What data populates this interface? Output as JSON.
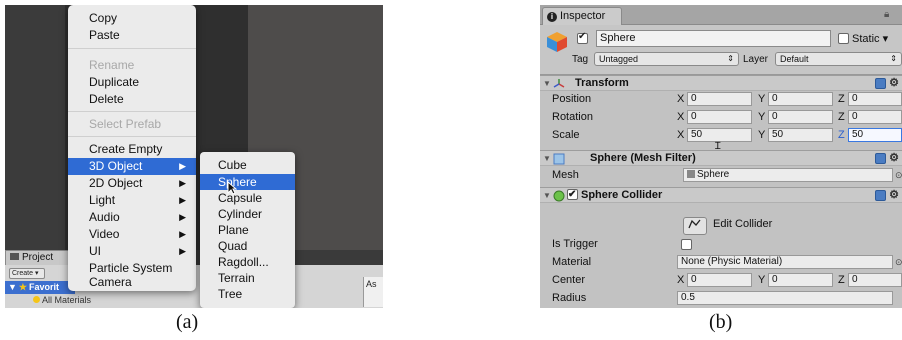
{
  "panel_a": {
    "context_menu": {
      "items": [
        {
          "label": "Copy",
          "enabled": true
        },
        {
          "label": "Paste",
          "enabled": true
        },
        {
          "label": "Rename",
          "enabled": false
        },
        {
          "label": "Duplicate",
          "enabled": true
        },
        {
          "label": "Delete",
          "enabled": true
        },
        {
          "label": "Select Prefab",
          "enabled": false
        },
        {
          "label": "Create Empty",
          "enabled": true
        },
        {
          "label": "3D Object",
          "enabled": true,
          "highlighted": true,
          "has_submenu": true
        },
        {
          "label": "2D Object",
          "enabled": true,
          "has_submenu": true
        },
        {
          "label": "Light",
          "enabled": true,
          "has_submenu": true
        },
        {
          "label": "Audio",
          "enabled": true,
          "has_submenu": true
        },
        {
          "label": "Video",
          "enabled": true,
          "has_submenu": true
        },
        {
          "label": "UI",
          "enabled": true,
          "has_submenu": true
        },
        {
          "label": "Particle System",
          "enabled": true
        },
        {
          "label": "Camera",
          "enabled": true
        }
      ],
      "submenu_arrow": "▶"
    },
    "submenu": {
      "items": [
        {
          "label": "Cube"
        },
        {
          "label": "Sphere",
          "highlighted": true
        },
        {
          "label": "Capsule"
        },
        {
          "label": "Cylinder"
        },
        {
          "label": "Plane"
        },
        {
          "label": "Quad"
        },
        {
          "label": "Ragdoll..."
        },
        {
          "label": "Terrain"
        },
        {
          "label": "Tree"
        }
      ]
    },
    "project_tab": "Project",
    "create_button": "Create ▾",
    "favorites_label": "Favorit",
    "all_materials": "All Materials",
    "right_box_label": "As",
    "caption": "(a)"
  },
  "panel_b": {
    "tab_title": "Inspector",
    "lock_icon": "lock-icon",
    "object": {
      "active": true,
      "name": "Sphere",
      "static_label": "Static ▾",
      "static": false,
      "tag_label": "Tag",
      "tag_value": "Untagged",
      "layer_label": "Layer",
      "layer_value": "Default"
    },
    "transform": {
      "title": "Transform",
      "rows": [
        {
          "label": "Position",
          "x": "0",
          "y": "0",
          "z": "0"
        },
        {
          "label": "Rotation",
          "x": "0",
          "y": "0",
          "z": "0"
        },
        {
          "label": "Scale",
          "x": "50",
          "y": "50",
          "z": "50"
        }
      ],
      "axes": {
        "x": "X",
        "y": "Y",
        "z": "Z"
      }
    },
    "mesh_filter": {
      "title": "Sphere (Mesh Filter)",
      "mesh_label": "Mesh",
      "mesh_value": "Sphere"
    },
    "sphere_collider": {
      "title": "Sphere Collider",
      "enabled": true,
      "edit_collider_label": "Edit Collider",
      "is_trigger_label": "Is Trigger",
      "is_trigger": false,
      "material_label": "Material",
      "material_value": "None (Physic Material)",
      "center_label": "Center",
      "center": {
        "x": "0",
        "y": "0",
        "z": "0"
      },
      "radius_label": "Radius",
      "radius_value": "0.5"
    },
    "object_picker_glyph": "⊙",
    "caption": "(b)"
  },
  "colors": {
    "menu_highlight": "#2f6bd4",
    "inspector_bg": "#c2c2c2",
    "field_bg": "#ececec"
  }
}
